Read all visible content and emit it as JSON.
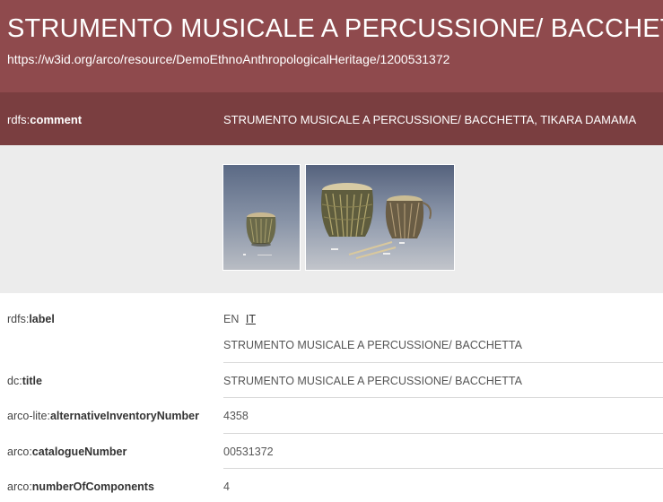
{
  "header": {
    "title": "STRUMENTO MUSICALE A PERCUSSIONE/ BACCHETTA",
    "uri": "https://w3id.org/arco/resource/DemoEthnoAnthropologicalHeritage/1200531372"
  },
  "comment": {
    "prefix": "rdfs:",
    "predicate": "comment",
    "value": "STRUMENTO MUSICALE A PERCUSSIONE/ BACCHETTA, TIKARA DAMAMA"
  },
  "gallery": {
    "images": [
      {
        "name": "drum-photo-single"
      },
      {
        "name": "drums-with-sticks-photo"
      }
    ]
  },
  "language_toggle": {
    "options": [
      "EN",
      "IT"
    ],
    "selected": "IT"
  },
  "properties": [
    {
      "prefix": "rdfs:",
      "predicate": "label",
      "value": "STRUMENTO MUSICALE A PERCUSSIONE/ BACCHETTA"
    },
    {
      "prefix": "dc:",
      "predicate": "title",
      "value": "STRUMENTO MUSICALE A PERCUSSIONE/ BACCHETTA"
    },
    {
      "prefix": "arco-lite:",
      "predicate": "alternativeInventoryNumber",
      "value": "4358"
    },
    {
      "prefix": "arco:",
      "predicate": "catalogueNumber",
      "value": "00531372"
    },
    {
      "prefix": "arco:",
      "predicate": "numberOfComponents",
      "value": "4"
    }
  ],
  "colors": {
    "header_bg": "#8f4a4d",
    "comment_bg": "#7a3e40",
    "gallery_bg": "#ececec"
  }
}
